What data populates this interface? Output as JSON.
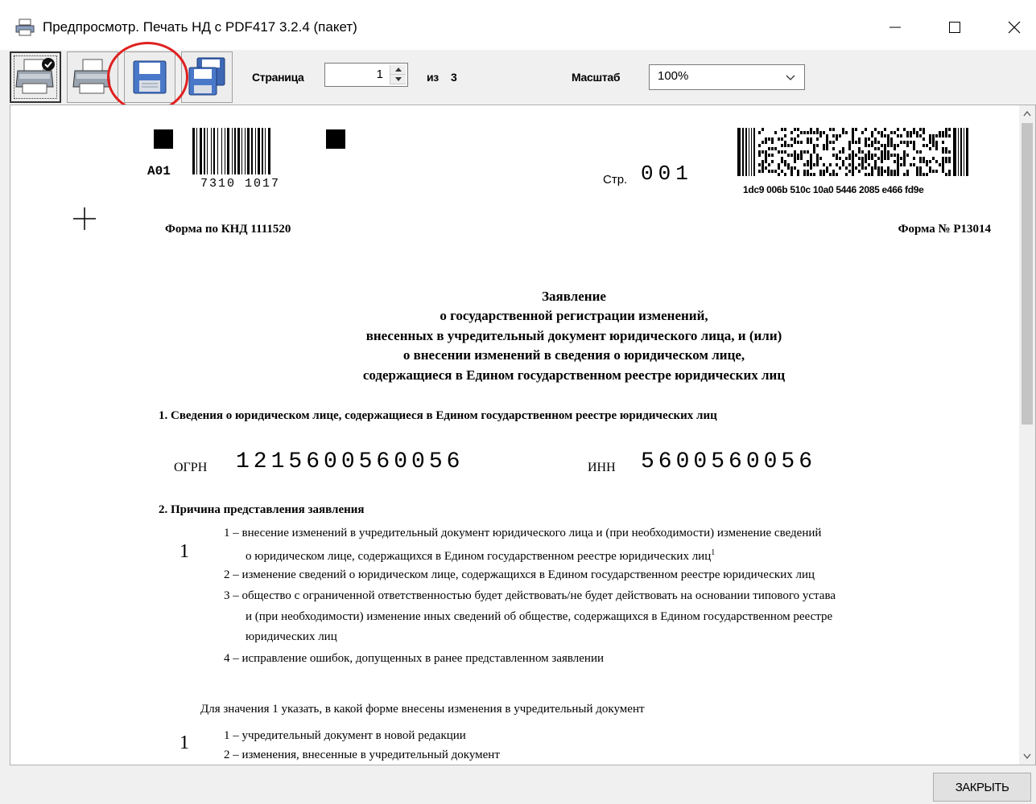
{
  "window": {
    "title": "Предпросмотр. Печать НД с PDF417 3.2.4 (пакет)",
    "icon": "printer-icon"
  },
  "toolbar": {
    "buttons": [
      {
        "name": "print-default-button",
        "icon": "printer-check-icon"
      },
      {
        "name": "print-button",
        "icon": "printer-icon"
      },
      {
        "name": "save-button",
        "icon": "floppy-disk-icon"
      },
      {
        "name": "save-all-button",
        "icon": "floppy-disks-icon"
      }
    ],
    "page_label": "Страница",
    "page_value": "1",
    "page_of": "из",
    "page_total": "3",
    "zoom_label": "Масштаб",
    "zoom_value": "100%"
  },
  "document": {
    "barcode_code": "A01",
    "barcode_digits": "7310 1017",
    "page_label": "Стр.",
    "page_number": "001",
    "pdf417_text": "1dc9 006b 510c 10a0 5446 2085 e466 fd9e",
    "form_knd": "Форма по КНД 1111520",
    "form_no": "Форма № Р13014",
    "title_lines": [
      "Заявление",
      "о государственной регистрации изменений,",
      "внесенных в учредительный документ юридического лица, и (или)",
      "о внесении изменений в сведения о юридическом лице,",
      "содержащиеся в Едином государственном реестре юридических лиц"
    ],
    "section1": "1. Сведения о юридическом лице, содержащиеся в Едином государственном реестре юридических лиц",
    "ogrn_label": "ОГРН",
    "ogrn_value": "1215600560056",
    "inn_label": "ИНН",
    "inn_value": "5600560056",
    "section2": "2. Причина представления заявления",
    "reason_value": "1",
    "reasons": [
      "1 – внесение изменений в учредительный документ юридического лица и (при необходимости) изменение сведений",
      "о юридическом лице, содержащихся в Едином государственном реестре юридических лиц",
      "2 – изменение сведений о юридическом лице, содержащихся в Едином государственном реестре юридических лиц",
      "3 – общество с ограниченной ответственностью будет действовать/не будет действовать на основании типового устава",
      "и (при необходимости) изменение иных сведений об обществе, содержащихся в Едином государственном реестре",
      "юридических лиц",
      "4 – исправление ошибок, допущенных в ранее представленном заявлении"
    ],
    "footnote_mark": "1",
    "form_prompt": "Для значения 1 указать, в какой форме внесены изменения в учредительный документ",
    "form_value": "1",
    "form_options": [
      "1 – учредительный документ в новой редакции",
      "2 – изменения, внесенные в учредительный документ"
    ]
  },
  "footer": {
    "close_label": "ЗАКРЫТЬ"
  }
}
